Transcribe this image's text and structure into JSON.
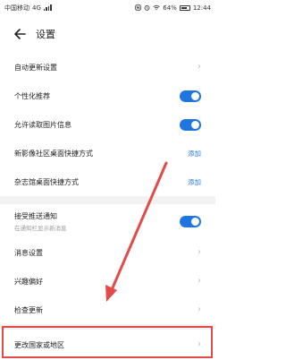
{
  "status_bar": {
    "carrier": "中国移动",
    "network": "4G",
    "icons": [
      "signal-icon",
      "nfc-icon",
      "alarm-icon",
      "wifi-icon",
      "battery-icon"
    ],
    "battery": "64%",
    "time": "12:44"
  },
  "header": {
    "title": "设置",
    "back_icon": "back-arrow-icon"
  },
  "rows": [
    {
      "label": "自动更新设置",
      "control": "chevron"
    },
    {
      "label": "个性化推荐",
      "control": "toggle",
      "on": true
    },
    {
      "label": "允许读取图片信息",
      "control": "toggle",
      "on": true
    },
    {
      "label": "新影像社区桌面快捷方式",
      "control": "link",
      "link_text": "添加"
    },
    {
      "label": "杂志馆桌面快捷方式",
      "control": "link",
      "link_text": "添加"
    },
    {
      "label": "接受推送通知",
      "sub": "在通知栏显示新消息",
      "control": "toggle",
      "on": true
    },
    {
      "label": "消息设置",
      "control": "chevron"
    },
    {
      "label": "兴趣偏好",
      "control": "chevron"
    },
    {
      "label": "检查更新",
      "control": "chevron"
    },
    {
      "label": "更改国家或地区",
      "control": "chevron"
    }
  ],
  "colors": {
    "accent": "#1e77e0",
    "link": "#2a7de1",
    "annotation": "#e34a4a"
  }
}
